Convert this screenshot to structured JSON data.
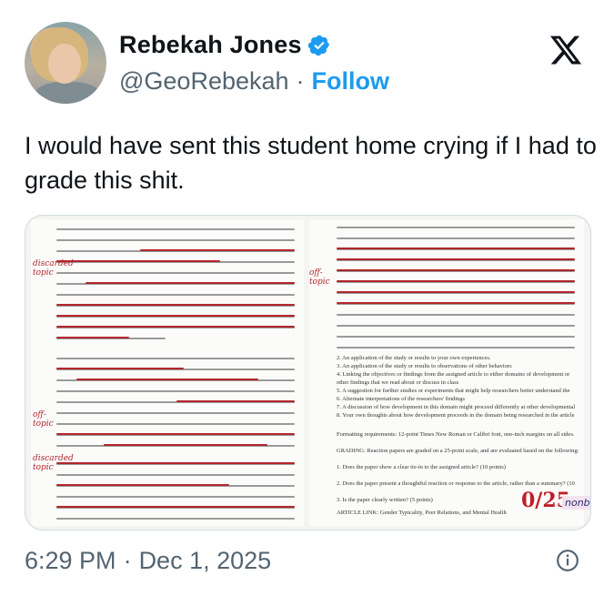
{
  "author": {
    "name": "Rebekah Jones",
    "handle": "@GeoRebekah",
    "separator": "·",
    "follow_label": "Follow"
  },
  "tweet": {
    "text": "I would have sent this student home crying if I had to grade this shit."
  },
  "media": {
    "margin_notes": [
      "discarded topic",
      "off-topic",
      "off-topic",
      "discarded topic"
    ],
    "right_items": [
      "2. An application of the study or results to your own experiences.",
      "3. An application of the study or results to observations of other behaviors",
      "4. Linking the objectives or findings from the assigned article to either domains of development or other findings that we read about or discuss in class",
      "5. A suggestion for further studies or experiments that might help researchers better understand the topic being studied",
      "6. Alternate interpretations of the researchers' findings",
      "7. A discussion of how development in this domain might proceed differently at other developmental stages",
      "8. Your own thoughts about how development proceeds in the domain being researched in the article",
      "Formatting requirements: 12-point Times New Roman or Calibri font, one-inch margins on all sides.",
      "GRADING: Reaction papers are graded on a 25-point scale, and are evaluated based on the following:",
      "1. Does the paper show a clear tie-in to the assigned article? (10 points)",
      "2. Does the paper present a thoughtful reaction or response to the article, rather than a summary? (10 points)",
      "3. Is the paper clearly written? (5 points)",
      "ARTICLE LINK: Gender Typicality, Peer Relations, and Mental Health"
    ],
    "grade": "0/25",
    "grade_note": "nonbinary"
  },
  "footer": {
    "time": "6:29 PM",
    "separator": "·",
    "date": "Dec 1, 2025"
  },
  "colors": {
    "link": "#1d9bf0",
    "muted": "#536471",
    "ink_red": "#b3262b"
  },
  "icons": [
    "verified-badge-icon",
    "x-logo-icon",
    "info-icon"
  ]
}
